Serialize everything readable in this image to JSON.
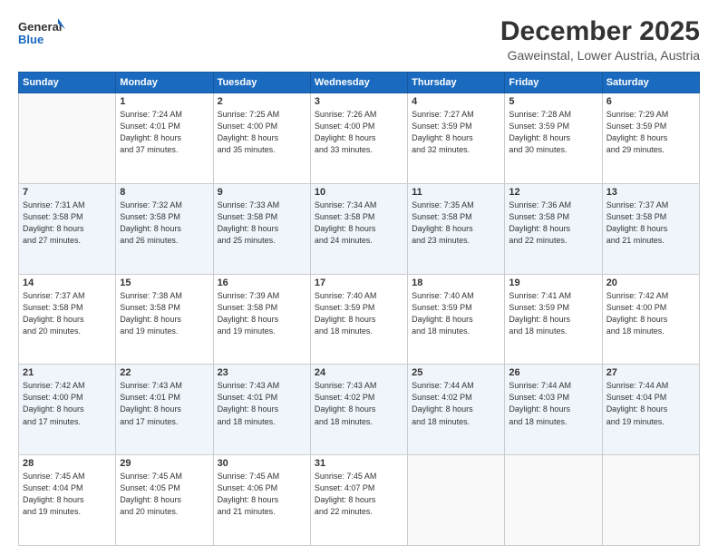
{
  "header": {
    "logo_general": "General",
    "logo_blue": "Blue",
    "month": "December 2025",
    "location": "Gaweinstal, Lower Austria, Austria"
  },
  "days_of_week": [
    "Sunday",
    "Monday",
    "Tuesday",
    "Wednesday",
    "Thursday",
    "Friday",
    "Saturday"
  ],
  "weeks": [
    [
      {
        "day": "",
        "info": ""
      },
      {
        "day": "1",
        "info": "Sunrise: 7:24 AM\nSunset: 4:01 PM\nDaylight: 8 hours\nand 37 minutes."
      },
      {
        "day": "2",
        "info": "Sunrise: 7:25 AM\nSunset: 4:00 PM\nDaylight: 8 hours\nand 35 minutes."
      },
      {
        "day": "3",
        "info": "Sunrise: 7:26 AM\nSunset: 4:00 PM\nDaylight: 8 hours\nand 33 minutes."
      },
      {
        "day": "4",
        "info": "Sunrise: 7:27 AM\nSunset: 3:59 PM\nDaylight: 8 hours\nand 32 minutes."
      },
      {
        "day": "5",
        "info": "Sunrise: 7:28 AM\nSunset: 3:59 PM\nDaylight: 8 hours\nand 30 minutes."
      },
      {
        "day": "6",
        "info": "Sunrise: 7:29 AM\nSunset: 3:59 PM\nDaylight: 8 hours\nand 29 minutes."
      }
    ],
    [
      {
        "day": "7",
        "info": "Sunrise: 7:31 AM\nSunset: 3:58 PM\nDaylight: 8 hours\nand 27 minutes."
      },
      {
        "day": "8",
        "info": "Sunrise: 7:32 AM\nSunset: 3:58 PM\nDaylight: 8 hours\nand 26 minutes."
      },
      {
        "day": "9",
        "info": "Sunrise: 7:33 AM\nSunset: 3:58 PM\nDaylight: 8 hours\nand 25 minutes."
      },
      {
        "day": "10",
        "info": "Sunrise: 7:34 AM\nSunset: 3:58 PM\nDaylight: 8 hours\nand 24 minutes."
      },
      {
        "day": "11",
        "info": "Sunrise: 7:35 AM\nSunset: 3:58 PM\nDaylight: 8 hours\nand 23 minutes."
      },
      {
        "day": "12",
        "info": "Sunrise: 7:36 AM\nSunset: 3:58 PM\nDaylight: 8 hours\nand 22 minutes."
      },
      {
        "day": "13",
        "info": "Sunrise: 7:37 AM\nSunset: 3:58 PM\nDaylight: 8 hours\nand 21 minutes."
      }
    ],
    [
      {
        "day": "14",
        "info": "Sunrise: 7:37 AM\nSunset: 3:58 PM\nDaylight: 8 hours\nand 20 minutes."
      },
      {
        "day": "15",
        "info": "Sunrise: 7:38 AM\nSunset: 3:58 PM\nDaylight: 8 hours\nand 19 minutes."
      },
      {
        "day": "16",
        "info": "Sunrise: 7:39 AM\nSunset: 3:58 PM\nDaylight: 8 hours\nand 19 minutes."
      },
      {
        "day": "17",
        "info": "Sunrise: 7:40 AM\nSunset: 3:59 PM\nDaylight: 8 hours\nand 18 minutes."
      },
      {
        "day": "18",
        "info": "Sunrise: 7:40 AM\nSunset: 3:59 PM\nDaylight: 8 hours\nand 18 minutes."
      },
      {
        "day": "19",
        "info": "Sunrise: 7:41 AM\nSunset: 3:59 PM\nDaylight: 8 hours\nand 18 minutes."
      },
      {
        "day": "20",
        "info": "Sunrise: 7:42 AM\nSunset: 4:00 PM\nDaylight: 8 hours\nand 18 minutes."
      }
    ],
    [
      {
        "day": "21",
        "info": "Sunrise: 7:42 AM\nSunset: 4:00 PM\nDaylight: 8 hours\nand 17 minutes."
      },
      {
        "day": "22",
        "info": "Sunrise: 7:43 AM\nSunset: 4:01 PM\nDaylight: 8 hours\nand 17 minutes."
      },
      {
        "day": "23",
        "info": "Sunrise: 7:43 AM\nSunset: 4:01 PM\nDaylight: 8 hours\nand 18 minutes."
      },
      {
        "day": "24",
        "info": "Sunrise: 7:43 AM\nSunset: 4:02 PM\nDaylight: 8 hours\nand 18 minutes."
      },
      {
        "day": "25",
        "info": "Sunrise: 7:44 AM\nSunset: 4:02 PM\nDaylight: 8 hours\nand 18 minutes."
      },
      {
        "day": "26",
        "info": "Sunrise: 7:44 AM\nSunset: 4:03 PM\nDaylight: 8 hours\nand 18 minutes."
      },
      {
        "day": "27",
        "info": "Sunrise: 7:44 AM\nSunset: 4:04 PM\nDaylight: 8 hours\nand 19 minutes."
      }
    ],
    [
      {
        "day": "28",
        "info": "Sunrise: 7:45 AM\nSunset: 4:04 PM\nDaylight: 8 hours\nand 19 minutes."
      },
      {
        "day": "29",
        "info": "Sunrise: 7:45 AM\nSunset: 4:05 PM\nDaylight: 8 hours\nand 20 minutes."
      },
      {
        "day": "30",
        "info": "Sunrise: 7:45 AM\nSunset: 4:06 PM\nDaylight: 8 hours\nand 21 minutes."
      },
      {
        "day": "31",
        "info": "Sunrise: 7:45 AM\nSunset: 4:07 PM\nDaylight: 8 hours\nand 22 minutes."
      },
      {
        "day": "",
        "info": ""
      },
      {
        "day": "",
        "info": ""
      },
      {
        "day": "",
        "info": ""
      }
    ]
  ]
}
